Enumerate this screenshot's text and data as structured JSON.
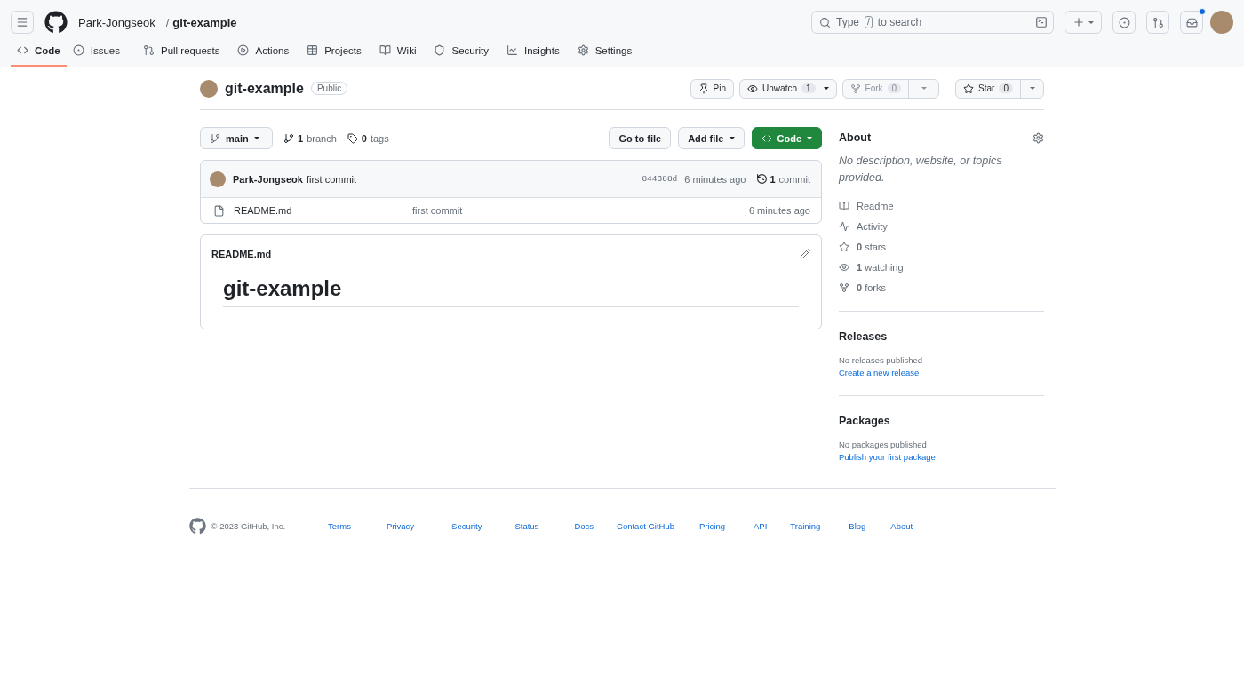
{
  "header": {
    "owner": "Park-Jongseok",
    "separator": "/",
    "repo": "git-example",
    "search": {
      "prefix": "Type",
      "key": "/",
      "suffix": "to search"
    },
    "inbox_unread": true
  },
  "tabs": [
    {
      "label": "Code",
      "kind": "code",
      "selected": true
    },
    {
      "label": "Issues",
      "kind": "issue",
      "selected": false
    },
    {
      "label": "Pull requests",
      "kind": "pr",
      "selected": false
    },
    {
      "label": "Actions",
      "kind": "actions",
      "selected": false
    },
    {
      "label": "Projects",
      "kind": "projects",
      "selected": false
    },
    {
      "label": "Wiki",
      "kind": "wiki",
      "selected": false
    },
    {
      "label": "Security",
      "kind": "security",
      "selected": false
    },
    {
      "label": "Insights",
      "kind": "insights",
      "selected": false
    },
    {
      "label": "Settings",
      "kind": "settings",
      "selected": false
    }
  ],
  "repo": {
    "name": "git-example",
    "visibility": "Public",
    "actions": [
      {
        "kind": "pin",
        "label": "Pin",
        "disabled": false
      },
      {
        "kind": "watch",
        "label": "Unwatch",
        "count": "1",
        "disabled": false
      },
      {
        "kind": "fork",
        "label": "Fork",
        "count": "0",
        "disabled": true
      },
      {
        "kind": "star",
        "label": "Star",
        "count": "0",
        "disabled": false
      }
    ]
  },
  "toolbar": {
    "branch": "main",
    "branches": {
      "count": "1",
      "label": "branch"
    },
    "tags": {
      "count": "0",
      "label": "tags"
    },
    "buttons": [
      {
        "kind": "plain",
        "label": "Go to file"
      },
      {
        "kind": "menu",
        "label": "Add file"
      },
      {
        "kind": "primary",
        "label": "Code"
      }
    ]
  },
  "commit": {
    "author": "Park-Jongseok",
    "message": "first commit",
    "sha": "844388d",
    "time": "6 minutes ago",
    "count": "1",
    "count_label": "commit"
  },
  "files": [
    {
      "kind": "file",
      "name": "README.md",
      "message": "first commit",
      "time": "6 minutes ago"
    }
  ],
  "readme": {
    "filename": "README.md",
    "heading": "git-example"
  },
  "about": {
    "title": "About",
    "description": "No description, website, or topics provided.",
    "items": [
      {
        "kind": "readme",
        "label": "Readme"
      },
      {
        "kind": "activity",
        "label": "Activity"
      },
      {
        "kind": "stars",
        "count": "0",
        "label": "stars"
      },
      {
        "kind": "watchers",
        "count": "1",
        "label": "watching"
      },
      {
        "kind": "forks",
        "count": "0",
        "label": "forks"
      }
    ]
  },
  "sections": [
    {
      "title": "Releases",
      "text": "No releases published",
      "link": "Create a new release"
    },
    {
      "title": "Packages",
      "text": "No packages published",
      "link": "Publish your first package"
    }
  ],
  "footer": {
    "copyright": "© 2023 GitHub, Inc.",
    "links": [
      "Terms",
      "Privacy",
      "Security",
      "Status",
      "Docs",
      "Contact GitHub",
      "Pricing",
      "API",
      "Training",
      "Blog",
      "About"
    ]
  }
}
